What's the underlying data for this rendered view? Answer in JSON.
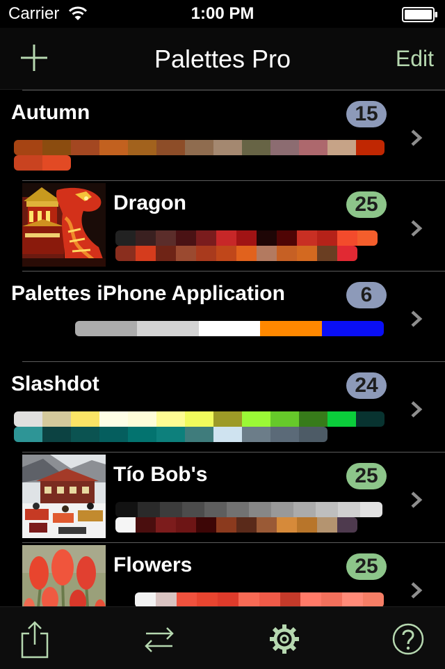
{
  "status_bar": {
    "carrier": "Carrier",
    "time": "1:00 PM"
  },
  "nav": {
    "title": "Palettes Pro",
    "edit_label": "Edit",
    "add_icon": "plus-icon"
  },
  "colors": {
    "accent": "#b6d8b0",
    "badge_blue": "#8d9ab9",
    "badge_green": "#8dc58a",
    "separator": "#5c5c5c",
    "chevron": "#8e8e8e"
  },
  "palettes": [
    {
      "title": "Autumn",
      "count": "15",
      "badge_color": "blue",
      "has_thumbnail": false,
      "thumbnail_icon": "",
      "swatches": [
        [
          "#a64413",
          "#8b4c0f",
          "#a34721",
          "#c2611f",
          "#a2621d",
          "#8d4d28",
          "#8f6c4f",
          "#a48870",
          "#676445",
          "#8c6c71",
          "#ad686d",
          "#c6a387",
          "#c02702"
        ],
        [
          "#c94320",
          "#e24a24"
        ]
      ]
    },
    {
      "title": "Dragon",
      "count": "25",
      "badge_color": "green",
      "has_thumbnail": true,
      "thumbnail_icon": "dragon-photo-icon",
      "swatches": [
        [
          "#222222",
          "#3a2020",
          "#5b2d2a",
          "#4a1214",
          "#7a1c1d",
          "#c72728",
          "#a01314",
          "#1e0606",
          "#4f0505",
          "#c82f23",
          "#b52219",
          "#f34b2c",
          "#f45e2c"
        ],
        [
          "#8a2e1e",
          "#d53c1d",
          "#6f2416",
          "#9b4a30",
          "#a93a1d",
          "#c0471a",
          "#e1621d",
          "#b37a60",
          "#c66024",
          "#d36920",
          "#6a3e22",
          "#e12933"
        ]
      ]
    },
    {
      "title": "Palettes iPhone Application",
      "count": "6",
      "badge_color": "blue",
      "has_thumbnail": false,
      "thumbnail_icon": "",
      "swatches": [
        [
          "#acacac",
          "#d4d4d4",
          "#ffffff",
          "#ff8800",
          "#0a0ff5"
        ]
      ]
    },
    {
      "title": "Slashdot",
      "count": "24",
      "badge_color": "blue",
      "has_thumbnail": false,
      "thumbnail_icon": "",
      "swatches": [
        [
          "#e1e0df",
          "#d4c99c",
          "#fbe466",
          "#fefee6",
          "#fefdd8",
          "#fefc93",
          "#f1fb5c",
          "#9d9a27",
          "#9bf936",
          "#66c92a",
          "#377b1a",
          "#0bcd3b",
          "#083330"
        ],
        [
          "#2e9596",
          "#0c4242",
          "#0b5351",
          "#055e5e",
          "#03736f",
          "#0d807c",
          "#3f7c7c",
          "#cfe3f0",
          "#6c7d89",
          "#5b6a78",
          "#4d5b66"
        ]
      ]
    },
    {
      "title": "Tío Bob's",
      "count": "25",
      "badge_color": "green",
      "has_thumbnail": true,
      "thumbnail_icon": "ski-lodge-photo-icon",
      "swatches": [
        [
          "#121212",
          "#2a2a2a",
          "#3c3c3c",
          "#4c4c4c",
          "#5e5e5e",
          "#727272",
          "#878787",
          "#999999",
          "#ababab",
          "#bebebe",
          "#d0d0d0",
          "#e2e2e2"
        ],
        [
          "#f5f5f5",
          "#4a0e0e",
          "#7c1c1c",
          "#6d1515",
          "#3d0606",
          "#8b3a1e",
          "#5a2a1a",
          "#9a5a36",
          "#d68a3a",
          "#b8752a",
          "#b49470",
          "#4e3a4e"
        ]
      ]
    },
    {
      "title": "Flowers",
      "count": "25",
      "badge_color": "green",
      "has_thumbnail": true,
      "thumbnail_icon": "flowers-photo-icon",
      "swatches": [
        [
          "#f2f2f2",
          "#d9c3c1",
          "#f0523e",
          "#e84530",
          "#de3b2b",
          "#f76a55",
          "#ef5a48",
          "#c43a2a",
          "#ff7a68",
          "#f2705c",
          "#ff8a78",
          "#f57e66"
        ]
      ]
    }
  ],
  "tab_bar": {
    "share_icon": "share-icon",
    "swap_icon": "swap-icon",
    "settings_icon": "gear-icon",
    "help_icon": "help-icon"
  }
}
